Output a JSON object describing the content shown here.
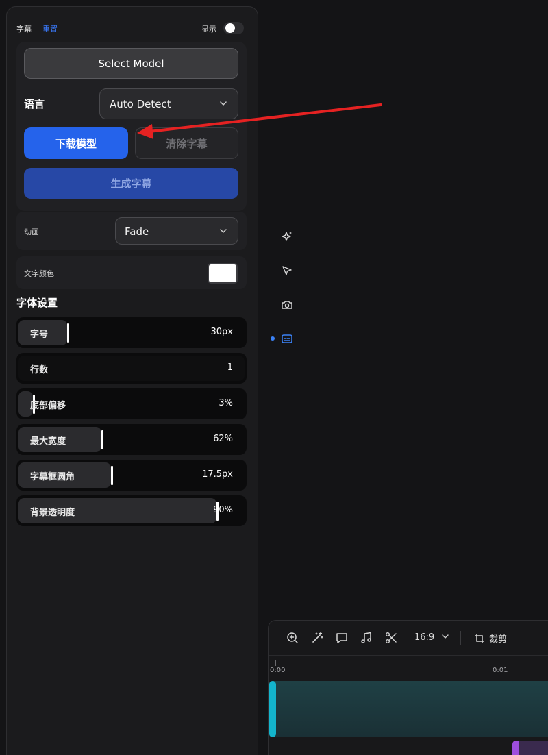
{
  "panel": {
    "title": "字幕",
    "reset_label": "重置",
    "show_label": "显示",
    "show_enabled": false
  },
  "model": {
    "select_model_label": "Select Model",
    "language_label": "语言",
    "language_value": "Auto Detect",
    "download_label": "下载模型",
    "clear_label": "清除字幕",
    "generate_label": "生成字幕"
  },
  "animation": {
    "label": "动画",
    "value": "Fade"
  },
  "text_color": {
    "label": "文字颜色",
    "value": "#ffffff"
  },
  "font_settings": {
    "title": "字体设置",
    "sliders": [
      {
        "label": "字号",
        "value": "30px",
        "fraction": 0.22
      },
      {
        "label": "行数",
        "value": "1",
        "fraction": 0
      },
      {
        "label": "底部偏移",
        "value": "3%",
        "fraction": 0.07
      },
      {
        "label": "最大宽度",
        "value": "62%",
        "fraction": 0.37
      },
      {
        "label": "字幕框圆角",
        "value": "17.5px",
        "fraction": 0.41
      },
      {
        "label": "背景透明度",
        "value": "90%",
        "fraction": 0.87
      }
    ]
  },
  "side_tools": [
    "sparkle-icon",
    "cursor-icon",
    "camera-icon",
    "subtitles-icon"
  ],
  "timeline": {
    "aspect_ratio": "16:9",
    "crop_label": "裁剪",
    "time_marks": [
      "0:00",
      "0:01"
    ]
  },
  "colors": {
    "accent": "#2563eb",
    "annotation_arrow": "#e52222",
    "video_track": "#13b4cc"
  }
}
